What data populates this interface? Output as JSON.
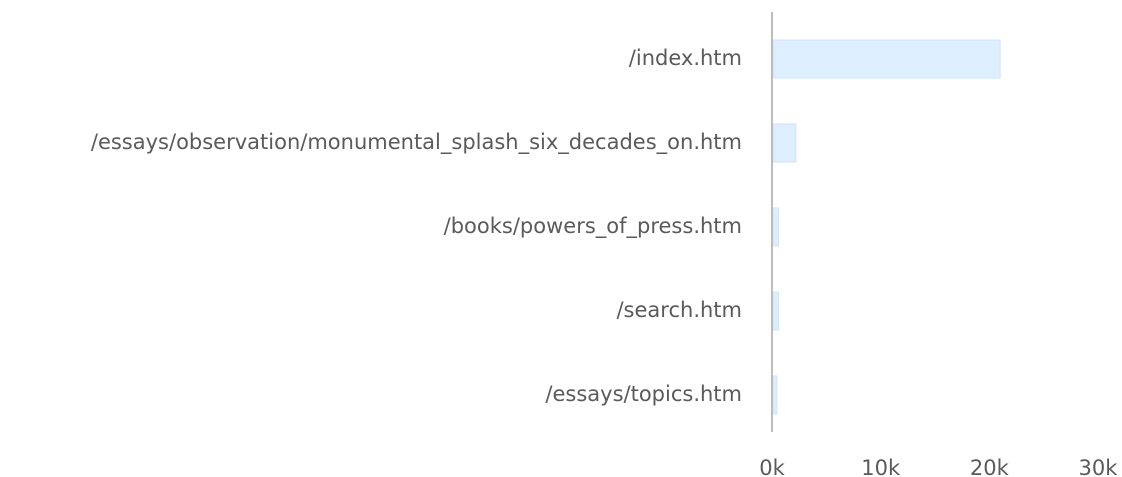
{
  "chart_data": {
    "type": "bar",
    "orientation": "horizontal",
    "categories": [
      "/index.htm",
      "/essays/observation/monumental_splash_six_decades_on.htm",
      "/books/powers_of_press.htm",
      "/search.htm",
      "/essays/topics.htm"
    ],
    "values": [
      21000,
      2200,
      600,
      600,
      450
    ],
    "xlim": [
      0,
      30000
    ],
    "xticks": [
      0,
      10000,
      20000,
      30000
    ],
    "xtick_labels": [
      "0k",
      "10k",
      "20k",
      "30k"
    ],
    "title": "",
    "xlabel": "",
    "ylabel": "",
    "grid": false,
    "colors": {
      "bar_fill": "#ddeeff",
      "bar_stroke": "#cfe3fb",
      "axis": "#bdbdbd",
      "text": "#5a5a5a"
    }
  }
}
